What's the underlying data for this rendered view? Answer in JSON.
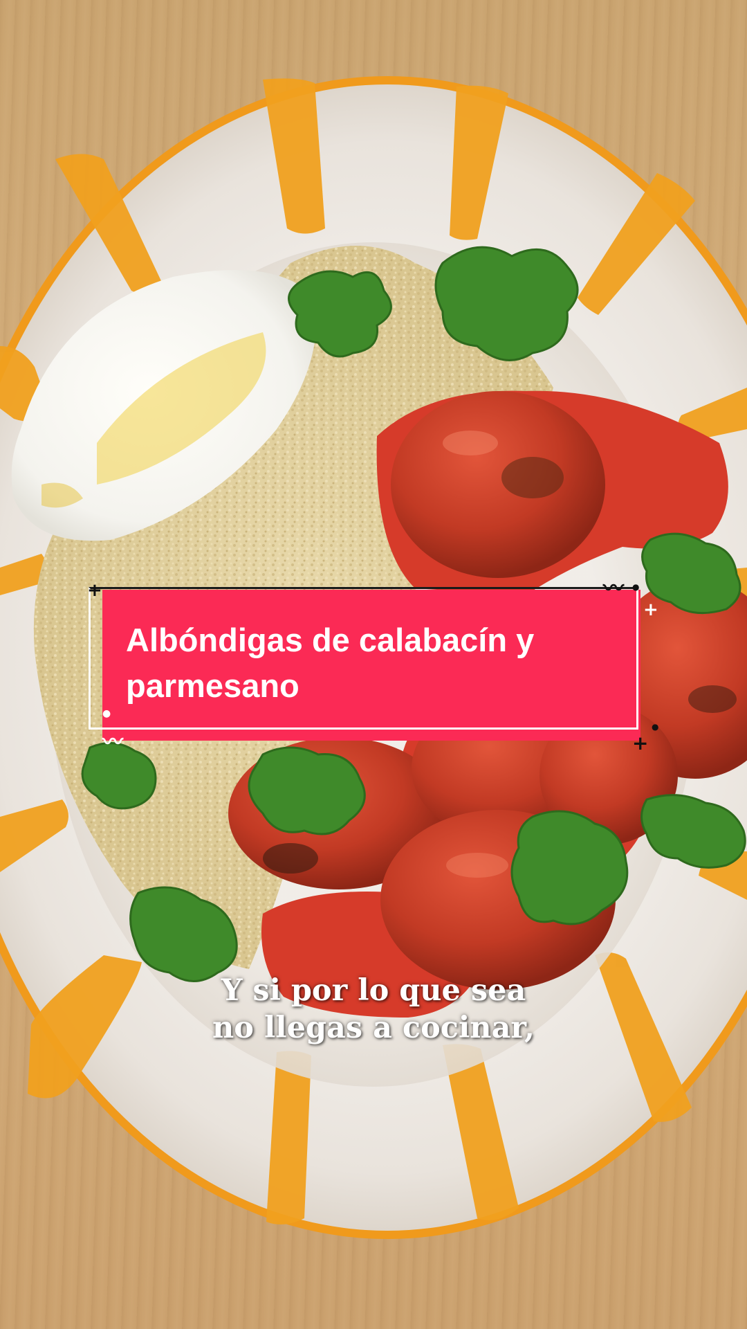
{
  "video": {
    "title_card": {
      "text": "Albóndigas de calabacín y parmesano",
      "colors": {
        "fill": "#fb2a55",
        "text": "#ffffff",
        "frame": "#ffffff"
      }
    },
    "caption": {
      "line1": "Y si por lo que sea",
      "line2": "no llegas a cocinar,"
    },
    "scene_colors": {
      "table": "#cfa775",
      "plate": "#f1ede8",
      "plate_stripes": "#f0a01f",
      "tomato_sauce": "#d63b2a",
      "couscous": "#e3d3a2",
      "yogurt": "#f7f6f1",
      "cilantro": "#3f8a2a"
    }
  }
}
